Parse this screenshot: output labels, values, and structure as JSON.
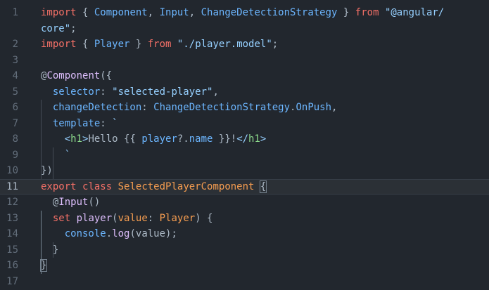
{
  "editor": {
    "line_numbers": [
      "1",
      "2",
      "3",
      "4",
      "5",
      "6",
      "7",
      "8",
      "9",
      "10",
      "11",
      "12",
      "13",
      "14",
      "15",
      "16",
      "17"
    ],
    "current_line": "11",
    "lines": [
      [
        {
          "t": "import",
          "c": "kw"
        },
        {
          "t": " { ",
          "c": "pl"
        },
        {
          "t": "Component",
          "c": "ent2"
        },
        {
          "t": ", ",
          "c": "pl"
        },
        {
          "t": "Input",
          "c": "ent2"
        },
        {
          "t": ", ",
          "c": "pl"
        },
        {
          "t": "ChangeDetectionStrategy",
          "c": "ent2"
        },
        {
          "t": " } ",
          "c": "pl"
        },
        {
          "t": "from",
          "c": "kw"
        },
        {
          "t": " ",
          "c": "pl"
        },
        {
          "t": "\"@angular/",
          "c": "str"
        }
      ],
      [
        {
          "t": "core\"",
          "c": "str"
        },
        {
          "t": ";",
          "c": "pl"
        }
      ],
      [
        {
          "t": "import",
          "c": "kw"
        },
        {
          "t": " { ",
          "c": "pl"
        },
        {
          "t": "Player",
          "c": "ent2"
        },
        {
          "t": " } ",
          "c": "pl"
        },
        {
          "t": "from",
          "c": "kw"
        },
        {
          "t": " ",
          "c": "pl"
        },
        {
          "t": "\"./player.model\"",
          "c": "str"
        },
        {
          "t": ";",
          "c": "pl"
        }
      ],
      [],
      [
        {
          "t": "@",
          "c": "pl"
        },
        {
          "t": "Component",
          "c": "fn"
        },
        {
          "t": "({",
          "c": "pl"
        }
      ],
      [
        {
          "t": "  selector",
          "c": "ent2"
        },
        {
          "t": ": ",
          "c": "pl"
        },
        {
          "t": "\"selected-player\"",
          "c": "str"
        },
        {
          "t": ",",
          "c": "pl"
        }
      ],
      [
        {
          "t": "  changeDetection",
          "c": "ent2"
        },
        {
          "t": ": ",
          "c": "pl"
        },
        {
          "t": "ChangeDetectionStrategy",
          "c": "ent2"
        },
        {
          "t": ".",
          "c": "pl"
        },
        {
          "t": "OnPush",
          "c": "ent2"
        },
        {
          "t": ",",
          "c": "pl"
        }
      ],
      [
        {
          "t": "  template",
          "c": "ent2"
        },
        {
          "t": ": ",
          "c": "pl"
        },
        {
          "t": "`",
          "c": "str"
        }
      ],
      [
        {
          "t": "    <",
          "c": "str"
        },
        {
          "t": "h1",
          "c": "tag"
        },
        {
          "t": ">",
          "c": "str"
        },
        {
          "t": "Hello {{ ",
          "c": "pl"
        },
        {
          "t": "player",
          "c": "ent2"
        },
        {
          "t": "?.",
          "c": "pl"
        },
        {
          "t": "name",
          "c": "ent2"
        },
        {
          "t": " }}!",
          "c": "pl"
        },
        {
          "t": "</",
          "c": "str"
        },
        {
          "t": "h1",
          "c": "tag"
        },
        {
          "t": ">",
          "c": "str"
        }
      ],
      [
        {
          "t": "    `",
          "c": "str"
        }
      ],
      [
        {
          "t": "})",
          "c": "pl"
        }
      ],
      [
        {
          "t": "export",
          "c": "kw"
        },
        {
          "t": " ",
          "c": "pl"
        },
        {
          "t": "class",
          "c": "kw"
        },
        {
          "t": " ",
          "c": "pl"
        },
        {
          "t": "SelectedPlayerComponent",
          "c": "gold"
        },
        {
          "t": " ",
          "c": "pl"
        },
        {
          "t": "{",
          "c": "pl",
          "box": true
        }
      ],
      [
        {
          "t": "  @",
          "c": "pl"
        },
        {
          "t": "Input",
          "c": "fn"
        },
        {
          "t": "()",
          "c": "pl"
        }
      ],
      [
        {
          "t": "  set",
          "c": "kw"
        },
        {
          "t": " ",
          "c": "pl"
        },
        {
          "t": "player",
          "c": "fn"
        },
        {
          "t": "(",
          "c": "pl"
        },
        {
          "t": "value",
          "c": "gold"
        },
        {
          "t": ": ",
          "c": "pl"
        },
        {
          "t": "Player",
          "c": "gold"
        },
        {
          "t": ") {",
          "c": "pl"
        }
      ],
      [
        {
          "t": "    console",
          "c": "ent2"
        },
        {
          "t": ".",
          "c": "pl"
        },
        {
          "t": "log",
          "c": "fn"
        },
        {
          "t": "(",
          "c": "pl"
        },
        {
          "t": "value",
          "c": "pl"
        },
        {
          "t": ");",
          "c": "pl"
        }
      ],
      [
        {
          "t": "  }",
          "c": "pl"
        }
      ],
      [
        {
          "t": "}",
          "c": "pl",
          "box": true
        }
      ],
      []
    ]
  },
  "colors": {
    "background": "#22272e",
    "keyword": "#f47067",
    "string": "#96d0ff",
    "entity": "#6cb6ff",
    "function": "#dcbdfb",
    "tag": "#8ddb8c",
    "class_name": "#f69d50"
  }
}
